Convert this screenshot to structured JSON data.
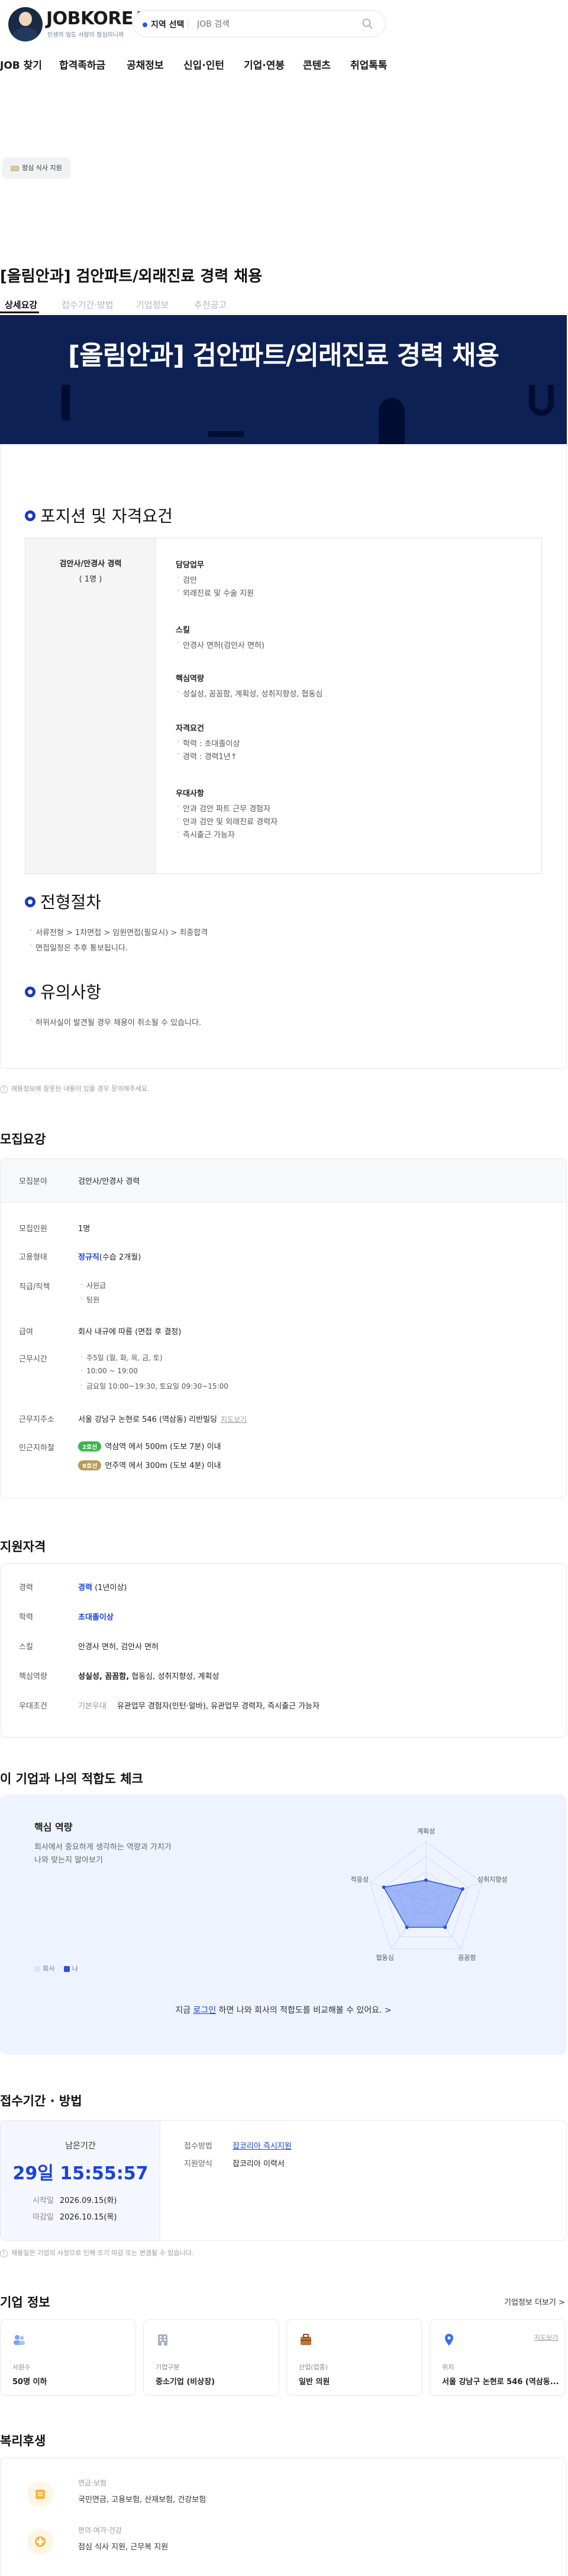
{
  "header": {
    "logo": "JOBKOREA",
    "logo_sub": "인생의 일도 사람이 점심이니까",
    "location_label": "지역 선택",
    "search_placeholder": "JOB 검색",
    "nav": [
      "JOB 찾기",
      "합격족하금",
      "공채정보",
      "신입·인턴",
      "기업·연봉",
      "콘텐츠",
      "취업톡톡"
    ]
  },
  "promo_chip": "정심 식사 지원",
  "job": {
    "title": "[올림안과] 검안파트/외래진료 경력 채용",
    "tabs": [
      "상세요강",
      "접수기간·방법",
      "기업정보",
      "추천공고"
    ],
    "banner_title": "[올림안과] 검안파트/외래진료 경력 채용"
  },
  "detail": {
    "section1": "포지션 및 자격요건",
    "position": "검안사/안경사 경력",
    "headcount": "( 1명 )",
    "groups": [
      {
        "title": "담당업무",
        "items": [
          "검안",
          "외래진료 및 수술 지원"
        ]
      },
      {
        "title": "스킬",
        "items": [
          "안경사 면허(검안사 면허)"
        ]
      },
      {
        "title": "핵심역량",
        "items": [
          "성실성, 꼼꼼함, 계획성, 성취지향성, 협동심"
        ]
      },
      {
        "title": "자격요건",
        "items": [
          "학력 : 초대졸이상",
          "경력 : 경력1년↑"
        ]
      },
      {
        "title": "우대사항",
        "items": [
          "안과 검안 파트 근무 경험자",
          "안과 검안 및 외래진료 경력자",
          "즉시출근 가능자"
        ]
      }
    ],
    "section2": "전형절차",
    "process": [
      "서류전형 > 1차면접 > 임원면접(필요시) > 최종합격",
      "면접일정은 추후 통보됩니다."
    ],
    "section3": "유의사항",
    "caution": "허위사실이 발견될 경우 채용이 취소될 수 있습니다."
  },
  "notice": "채용정보에 잘못된 내용이 있을 경우 문의해주세요.",
  "summary": {
    "title": "모집요강",
    "rows": {
      "field_label": "모집분야",
      "field": "검안사/안경사 경력",
      "count_label": "모집인원",
      "count": "1명",
      "type_label": "고용형태",
      "type_main": "정규직",
      "type_sub": "(수습 2개월)",
      "rank_label": "직급/직책",
      "rank": [
        "사원급",
        "팀원"
      ],
      "salary_label": "급여",
      "salary": "회사 내규에 따름 (면접 후 결정)",
      "hours_label": "근무시간",
      "hours": [
        "주5일 (월, 화, 목, 금, 토)",
        "10:00 ~ 19:00",
        "금요일 10:00~19:30, 토요일 09:30~15:00"
      ],
      "addr_label": "근무지주소",
      "addr": "서울 강남구 논현로 546 (역삼동) 리반빌딩",
      "addr_map": "지도보기",
      "station_label": "인근지하철",
      "stations": [
        {
          "line": "2호선",
          "color": "#3bb54a",
          "text": "역삼역 에서 500m (도보 7분) 이내"
        },
        {
          "line": "9호선",
          "color": "#b99a5a",
          "text": "언주역 에서 300m (도보 4분) 이내"
        }
      ]
    }
  },
  "qualify": {
    "title": "지원자격",
    "exp_label": "경력",
    "exp_main": "경력",
    "exp_sub": "(1년이상)",
    "edu_label": "학력",
    "edu": "초대졸이상",
    "skill_label": "스킬",
    "skill": "안경사 면허, 검안사 면허",
    "core_label": "핵심역량",
    "core_bold": "성실성, 꼼꼼함,",
    "core_rest": " 협동심, 성취지향성, 계획성",
    "pref_label": "우대조건",
    "pref_key": "기본우대",
    "pref": "유관업무 경험자(인턴·알바), 유관업무 경력자, 즉시출근 가능자"
  },
  "fit": {
    "title": "이 기업과 나의 적합도 체크",
    "card_title": "핵심 역량",
    "desc1": "회사에서 중요하게 생각하는 역량과 가치가",
    "desc2": "나와 맞는지 알아보기",
    "legend_company": "회사",
    "legend_me": "나",
    "axes": [
      "계획성",
      "성취지향성",
      "꼼꼼함",
      "협동심",
      "적응성"
    ],
    "company_values": [
      0.35,
      0.65,
      0.55,
      0.55,
      0.75
    ],
    "cta_pre": "지금 ",
    "cta_link": "로그인",
    "cta_post": " 하면 나와 회사의 적합도를 비교해볼 수 있어요.",
    "color_company": "#c7d2ee",
    "color_me": "#2b4fe0"
  },
  "apply": {
    "title": "접수기간 · 방법",
    "remain_label": "남은기간",
    "remain": "29일 15:55:57",
    "start_label": "시작일",
    "start": "2026.09.15(화)",
    "end_label": "마감일",
    "end": "2026.10.15(목)",
    "method_label": "접수방법",
    "method": "잡코리아 즉시지원",
    "form_label": "지원양식",
    "form": "잡코리아 이력서",
    "notice": "채용일은 기업의 사정으로 인해 조기 마감 또는 변경될 수 있습니다."
  },
  "company": {
    "title": "기업 정보",
    "more": "기업정보 더보기",
    "cards": [
      {
        "icon": "people-icon",
        "key": "사원수",
        "value": "50명 이하"
      },
      {
        "icon": "building-icon",
        "key": "기업구분",
        "value": "중소기업 (비상장)"
      },
      {
        "icon": "briefcase-icon",
        "key": "산업(업종)",
        "value": "일반 의원"
      },
      {
        "icon": "location-icon",
        "key": "위치",
        "value": "서울 강남구 논현로 546 (역삼동...",
        "link": "지도보기"
      }
    ]
  },
  "welfare": {
    "title": "복리후생",
    "items": [
      {
        "key": "연금·보험",
        "value": "국민연금, 고용보험, 산재보험, 건강보험"
      },
      {
        "key": "편의·여가·건강",
        "value": "점심 식사 지원, 근무복 지원"
      }
    ]
  }
}
